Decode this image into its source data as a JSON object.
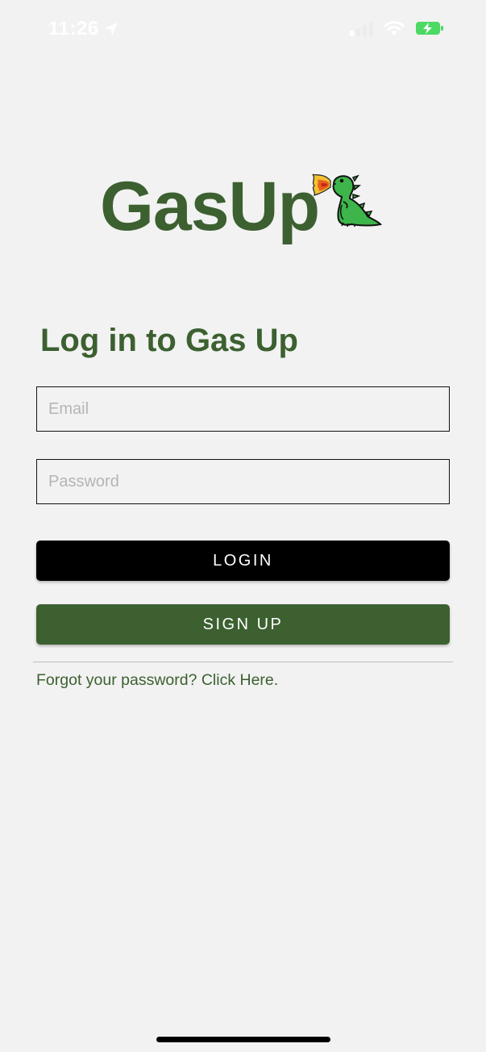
{
  "status_bar": {
    "time": "11:26",
    "icons": [
      "location-arrow-icon",
      "cellular-signal-icon",
      "wifi-icon",
      "battery-charging-icon"
    ],
    "battery_color": "#4cd964"
  },
  "logo": {
    "text": "GasUp",
    "mascot": "fire-breathing-dinosaur-icon"
  },
  "login": {
    "title": "Log in to Gas Up",
    "email_placeholder": "Email",
    "email_value": "",
    "password_placeholder": "Password",
    "password_value": "",
    "login_label": "LOGIN",
    "signup_label": "SIGN UP",
    "forgot_label": "Forgot your password? Click Here."
  },
  "colors": {
    "brand_green": "#3c6030",
    "background": "#f2f2f2",
    "login_button": "#000000"
  }
}
